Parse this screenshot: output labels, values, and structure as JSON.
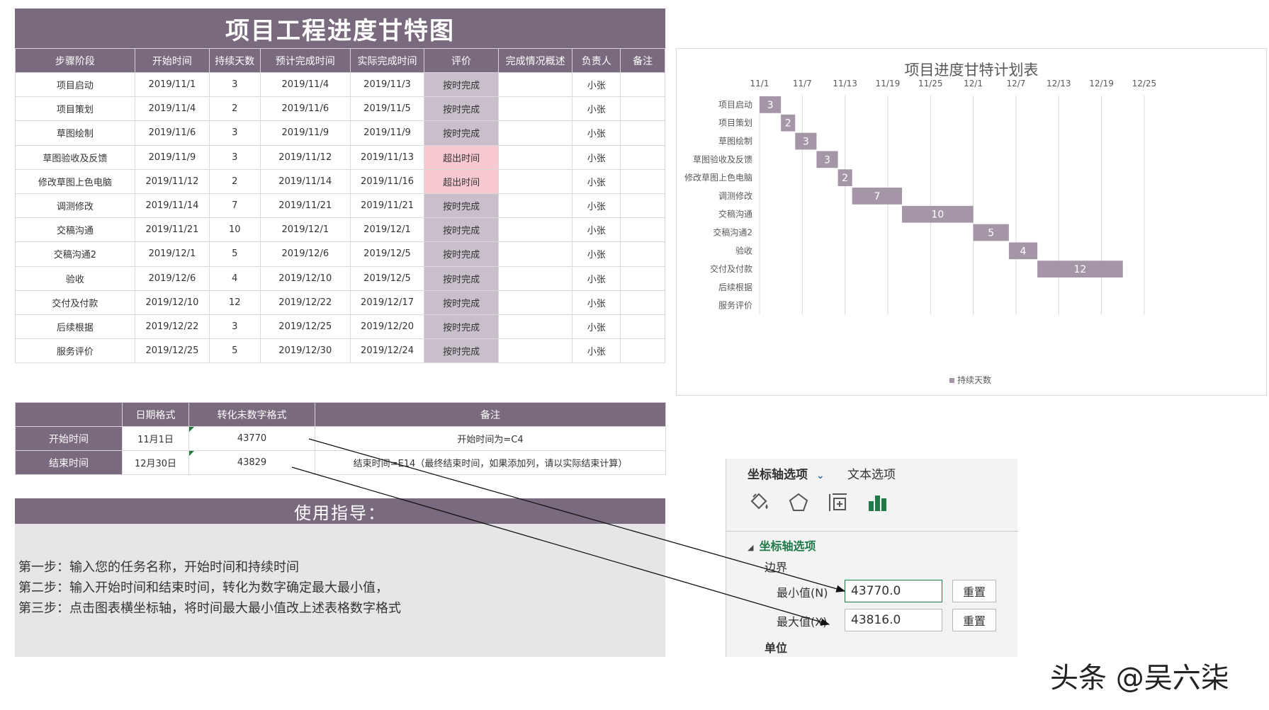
{
  "main": {
    "title": "项目工程进度甘特图",
    "headers": [
      "步骤阶段",
      "开始时间",
      "持续天数",
      "预计完成时间",
      "实际完成时间",
      "评价",
      "完成情况概述",
      "负责人",
      "备注"
    ],
    "rows": [
      {
        "stage": "项目启动",
        "start": "2019/11/1",
        "days": "3",
        "plan_end": "2019/11/4",
        "actual_end": "2019/11/3",
        "eval": "按时完成",
        "eval_status": "ok",
        "summary": "",
        "owner": "小张",
        "note": ""
      },
      {
        "stage": "项目策划",
        "start": "2019/11/4",
        "days": "2",
        "plan_end": "2019/11/6",
        "actual_end": "2019/11/5",
        "eval": "按时完成",
        "eval_status": "ok",
        "summary": "",
        "owner": "小张",
        "note": ""
      },
      {
        "stage": "草图绘制",
        "start": "2019/11/6",
        "days": "3",
        "plan_end": "2019/11/9",
        "actual_end": "2019/11/9",
        "eval": "按时完成",
        "eval_status": "ok",
        "summary": "",
        "owner": "小张",
        "note": ""
      },
      {
        "stage": "草图验收及反馈",
        "start": "2019/11/9",
        "days": "3",
        "plan_end": "2019/11/12",
        "actual_end": "2019/11/13",
        "eval": "超出时间",
        "eval_status": "late",
        "summary": "",
        "owner": "小张",
        "note": ""
      },
      {
        "stage": "修改草图上色电脑",
        "start": "2019/11/12",
        "days": "2",
        "plan_end": "2019/11/14",
        "actual_end": "2019/11/16",
        "eval": "超出时间",
        "eval_status": "late",
        "summary": "",
        "owner": "小张",
        "note": ""
      },
      {
        "stage": "调测修改",
        "start": "2019/11/14",
        "days": "7",
        "plan_end": "2019/11/21",
        "actual_end": "2019/11/21",
        "eval": "按时完成",
        "eval_status": "ok",
        "summary": "",
        "owner": "小张",
        "note": ""
      },
      {
        "stage": "交稿沟通",
        "start": "2019/11/21",
        "days": "10",
        "plan_end": "2019/12/1",
        "actual_end": "2019/12/1",
        "eval": "按时完成",
        "eval_status": "ok",
        "summary": "",
        "owner": "小张",
        "note": ""
      },
      {
        "stage": "交稿沟通2",
        "start": "2019/12/1",
        "days": "5",
        "plan_end": "2019/12/6",
        "actual_end": "2019/12/5",
        "eval": "按时完成",
        "eval_status": "ok",
        "summary": "",
        "owner": "小张",
        "note": ""
      },
      {
        "stage": "验收",
        "start": "2019/12/6",
        "days": "4",
        "plan_end": "2019/12/10",
        "actual_end": "2019/12/5",
        "eval": "按时完成",
        "eval_status": "ok",
        "summary": "",
        "owner": "小张",
        "note": ""
      },
      {
        "stage": "交付及付款",
        "start": "2019/12/10",
        "days": "12",
        "plan_end": "2019/12/22",
        "actual_end": "2019/12/17",
        "eval": "按时完成",
        "eval_status": "ok",
        "summary": "",
        "owner": "小张",
        "note": ""
      },
      {
        "stage": "后续根据",
        "start": "2019/12/22",
        "days": "3",
        "plan_end": "2019/12/25",
        "actual_end": "2019/12/20",
        "eval": "按时完成",
        "eval_status": "ok",
        "summary": "",
        "owner": "小张",
        "note": ""
      },
      {
        "stage": "服务评价",
        "start": "2019/12/25",
        "days": "5",
        "plan_end": "2019/12/30",
        "actual_end": "2019/12/24",
        "eval": "按时完成",
        "eval_status": "ok",
        "summary": "",
        "owner": "小张",
        "note": ""
      }
    ]
  },
  "conversion": {
    "headers": [
      "",
      "日期格式",
      "转化未数字格式",
      "备注"
    ],
    "rows": [
      {
        "label": "开始时间",
        "date": "11月1日",
        "number": "43770",
        "note": "开始时间为=C4"
      },
      {
        "label": "结束时间",
        "date": "12月30日",
        "number": "43829",
        "note": "结束时间=E14（最终结束时间，如果添加列，请以实际结束计算）"
      }
    ]
  },
  "guide": {
    "title": "使用指导：",
    "steps": [
      "第一步：输入您的任务名称，开始时间和持续时间",
      "第二步：输入开始时间和结束时间，转化为数字确定最大最小值，",
      "第三步：点击图表横坐标轴，将时间最大最小值改上述表格数字格式"
    ]
  },
  "chart_data": {
    "type": "bar",
    "orientation": "horizontal-stacked-gantt",
    "title": "项目进度甘特计划表",
    "categories": [
      "项目启动",
      "项目策划",
      "草图绘制",
      "草图验收及反馈",
      "修改草图上色电脑",
      "调测修改",
      "交稿沟通",
      "交稿沟通2",
      "验收",
      "交付及付款",
      "后续根据",
      "服务评价"
    ],
    "x_tick_labels": [
      "11/1",
      "11/7",
      "11/13",
      "11/19",
      "11/25",
      "12/1",
      "12/7",
      "12/13",
      "12/19",
      "12/25"
    ],
    "x_tick_values": [
      43770,
      43776,
      43782,
      43788,
      43794,
      43800,
      43806,
      43812,
      43818,
      43824
    ],
    "xlim": [
      43770,
      43826
    ],
    "start_values": [
      43770,
      43773,
      43775,
      43778,
      43781,
      43783,
      43790,
      43800,
      43805,
      43809,
      43821,
      43824
    ],
    "series": [
      {
        "name": "持续天数",
        "values": [
          3,
          2,
          3,
          3,
          2,
          7,
          10,
          5,
          4,
          12,
          null,
          null
        ],
        "color": "#a495a7"
      }
    ],
    "legend_position": "bottom",
    "grid": true
  },
  "axis_panel": {
    "tab_axis": "坐标轴选项",
    "tab_axis_chevron": "chevron-down-icon",
    "tab_text": "文本选项",
    "icons": [
      "fill-bucket-icon",
      "pentagon-icon",
      "size-properties-icon",
      "bar-chart-icon"
    ],
    "section": "坐标轴选项",
    "bounds_label": "边界",
    "min_label": "最小值(N)",
    "min_value": "43770.0",
    "max_label": "最大值(X)",
    "max_value": "43816.0",
    "reset_label": "重置",
    "units_label": "单位"
  },
  "watermark": "头条 @吴六柒",
  "colors": {
    "header": "#7a6a7d",
    "eval_ok_bg": "#c8bfcb",
    "eval_ok_text": "#2e8b3a",
    "eval_late_bg": "#f8c9d0",
    "eval_late_text": "#d6203c",
    "bar": "#a495a7",
    "panel_accent": "#1e7b48"
  }
}
